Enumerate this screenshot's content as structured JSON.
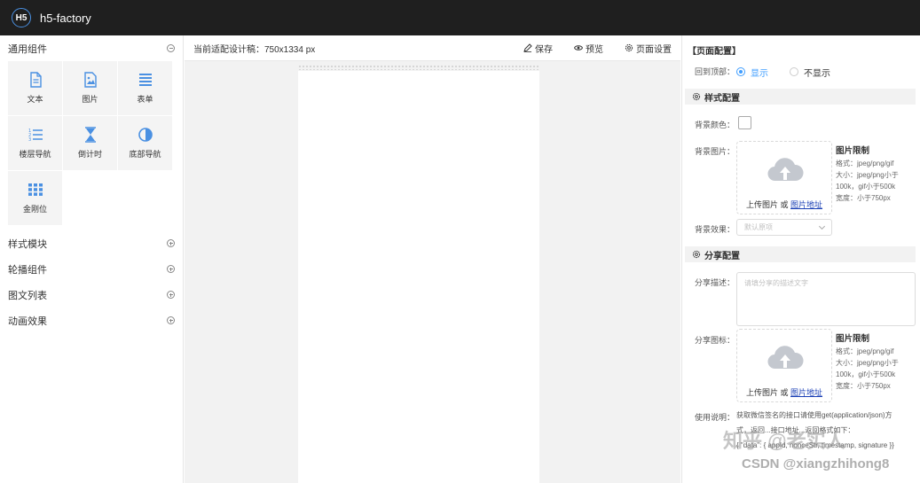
{
  "header": {
    "logo_text": "H5",
    "app_title": "h5-factory"
  },
  "sidebar": {
    "groups": [
      {
        "label": "通用组件",
        "expanded": true
      },
      {
        "label": "样式模块",
        "expanded": false
      },
      {
        "label": "轮播组件",
        "expanded": false
      },
      {
        "label": "图文列表",
        "expanded": false
      },
      {
        "label": "动画效果",
        "expanded": false
      }
    ],
    "tiles": [
      {
        "label": "文本",
        "icon": "document-icon"
      },
      {
        "label": "图片",
        "icon": "image-icon"
      },
      {
        "label": "表单",
        "icon": "list-icon"
      },
      {
        "label": "楼层导航",
        "icon": "ordered-list-icon"
      },
      {
        "label": "倒计时",
        "icon": "hourglass-icon"
      },
      {
        "label": "底部导航",
        "icon": "half-circle-icon"
      },
      {
        "label": "金刚位",
        "icon": "grid-icon"
      }
    ]
  },
  "canvas_toolbar": {
    "size_label": "当前适配设计稿：750x1334 px",
    "save_label": "保存",
    "preview_label": "预览",
    "settings_label": "页面设置"
  },
  "page_config": {
    "title": "【页面配置】",
    "back_to_top_label": "回到顶部：",
    "show_label": "显示",
    "hide_label": "不显示",
    "selected": "显示",
    "style_section": "样式配置",
    "bg_color_label": "背景颜色：",
    "bg_image_label": "背景图片：",
    "upload_text": "上传图片 或",
    "upload_link": "图片地址",
    "limit_title": "图片限制",
    "limit_format": "格式：jpeg/png/gif",
    "limit_size_a": "大小：jpeg/png小于",
    "limit_size_b": "100k，gif小于500k",
    "limit_width": "宽度：小于750px",
    "bg_effect_label": "背景效果：",
    "bg_effect_placeholder": "默认原项",
    "share_section": "分享配置",
    "share_desc_label": "分享描述：",
    "share_desc_placeholder": "请填分享的描述文字",
    "share_icon_label": "分享图标：",
    "usage_label": "使用说明：",
    "usage_line1": "获取微信签名的接口请使用get(application/json)方",
    "usage_line2": "式，返回...接口地址...返回格式如下：",
    "usage_line3": "{ \"data\": { appId, nonceStr, timestamp, signature }}"
  },
  "watermark": {
    "line1": "知乎 @老实人",
    "line2": "CSDN @xiangzhihong8"
  },
  "colors": {
    "accent": "#409eff",
    "topbar": "#1f1f1f",
    "link": "#1a3fb5"
  }
}
